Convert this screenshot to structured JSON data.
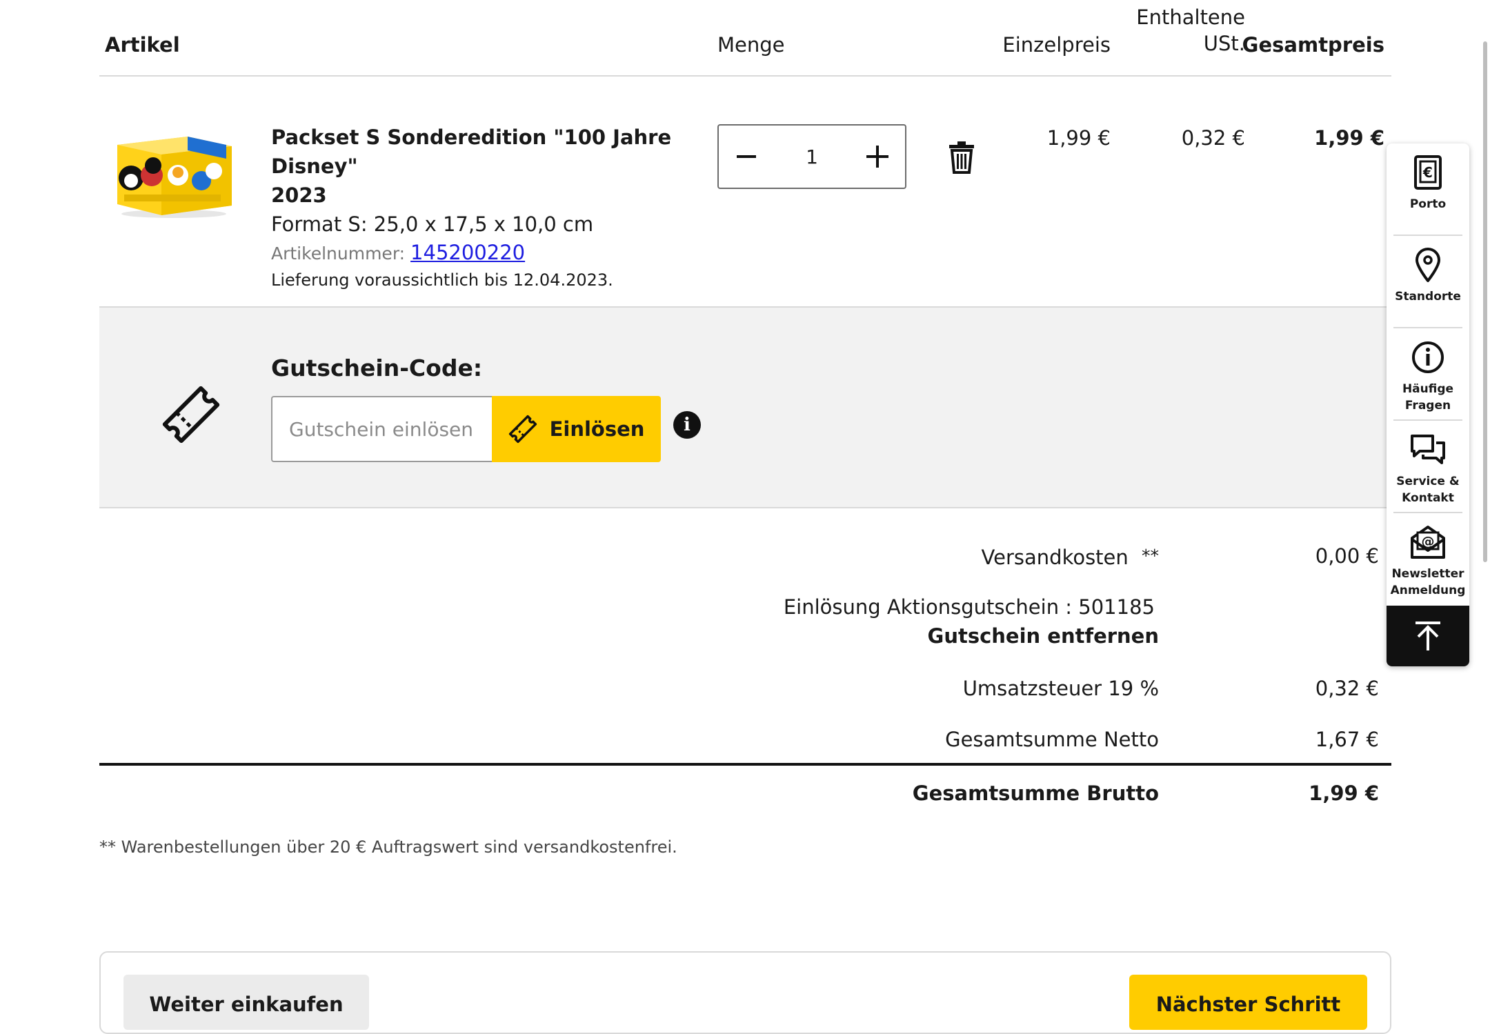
{
  "table_header": {
    "artikel": "Artikel",
    "menge": "Menge",
    "einzelpreis": "Einzelpreis",
    "ust_line1": "Enthaltene",
    "ust_line2": "USt.",
    "gesamtpreis": "Gesamtpreis"
  },
  "product": {
    "title_line1": "Packset S Sonderedition \"100 Jahre Disney\"",
    "title_line2": "2023",
    "format": "Format S: 25,0 x 17,5 x 10,0 cm",
    "artnr_label": "Artikelnummer:",
    "artnr": "145200220",
    "delivery": "Lieferung voraussichtlich bis 12.04.2023.",
    "quantity": "1",
    "unit_price": "1,99 €",
    "vat": "0,32 €",
    "total": "1,99 €"
  },
  "coupon": {
    "label": "Gutschein-Code:",
    "placeholder": "Gutschein einlösen",
    "button": "Einlösen"
  },
  "totals": {
    "shipping_label": "Versandkosten",
    "shipping_mark": "**",
    "shipping_value": "0,00 €",
    "promo_label": "Einlösung Aktionsgutschein : 501185",
    "promo_remove": "Gutschein entfernen",
    "vat_label": "Umsatzsteuer 19 %",
    "vat_value": "0,32 €",
    "net_label": "Gesamtsumme Netto",
    "net_value": "1,67 €",
    "gross_label": "Gesamtsumme Brutto",
    "gross_value": "1,99 €"
  },
  "footnote": "** Warenbestellungen über 20 € Auftragswert sind versandkostenfrei.",
  "buttons": {
    "continue": "Weiter einkaufen",
    "next": "Nächster Schritt"
  },
  "side_panel": {
    "items": [
      {
        "label": "Porto",
        "icon": "euro-document-icon"
      },
      {
        "label": "Standorte",
        "icon": "location-pin-icon"
      },
      {
        "label": "Häufige Fragen",
        "icon": "info-icon"
      },
      {
        "label": "Service & Kontakt",
        "icon": "chat-bubbles-icon"
      },
      {
        "label": "Newsletter Anmeldung",
        "icon": "newsletter-icon"
      }
    ],
    "back_to_top_icon": "arrow-up-icon"
  },
  "colors": {
    "accent_yellow": "#ffcc00",
    "link_blue": "#1d1de0",
    "panel_grey": "#f2f2f2"
  }
}
